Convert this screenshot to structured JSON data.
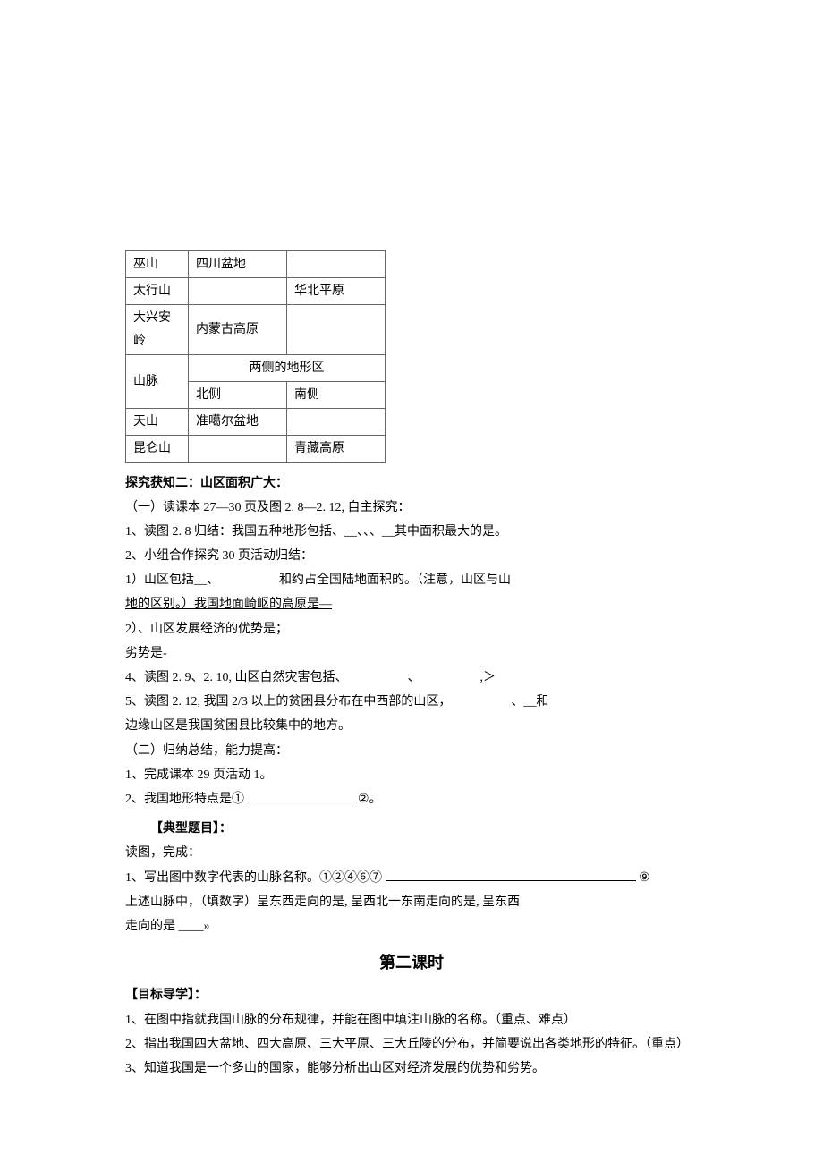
{
  "table1": {
    "rows": [
      [
        "巫山",
        "四川盆地",
        ""
      ],
      [
        "太行山",
        "",
        "华北平原"
      ],
      [
        "大兴安岭",
        "内蒙古高原",
        ""
      ]
    ],
    "header2_label": "两侧的地形区",
    "mountain_label": "山脉",
    "sub_north": "北侧",
    "sub_south": "南侧",
    "rows2": [
      [
        "天山",
        "准噶尔盆地",
        ""
      ],
      [
        "昆仑山",
        "",
        "青藏高原"
      ]
    ]
  },
  "section2": {
    "title": "探究获知二：山区面积广大：",
    "part1_intro": "（一）读课本 27—30 页及图 2. 8—2. 12, 自主探究：",
    "item1": "1、读图 2. 8 归结：我国五种地形包括、__、、、__其中面积最大的是。",
    "item2": "2、小组合作探究 30 页活动归结：",
    "item2_1a": "1）山区包括__、",
    "item2_1b": "和约占全国陆地面积的。（注意，山区与山",
    "item2_1c": "地的区别。）我国地面崎岖的高原是—",
    "item2_2a": "2）、山区发展经济的优势是；",
    "item2_2b": "劣势是-",
    "item4": "4、读图 2. 9、2. 10, 山区自然灾害包括、",
    "item4_mid": "、",
    "item4_end": ",＞",
    "item5a": "5、读图 2. 12, 我国 2/3 以上的贫困县分布在中西部的山区，",
    "item5b": "、__和",
    "item5c": "边缘山区是我国贫困县比较集中的地方。",
    "part2_intro": "（二）归纳总结，能力提高：",
    "part2_1": "1、完成课本 29 页活动 1。",
    "part2_2a": "2、我国地形特点是① ",
    "part2_2b": "②。"
  },
  "typical": {
    "title": "【典型题目】：",
    "intro": "读图，完成：",
    "q1a": "1、写出图中数字代表的山脉名称。①②④⑥⑦",
    "q1b": "⑨",
    "q1c": "上述山脉中，（填数字）呈东西走向的是, 呈西北一东南走向的是, 呈东西",
    "q1d": "走向的是 ____»"
  },
  "lesson2": {
    "title": "第二课时",
    "goal_title": "【目标导学】：",
    "goal1": "1、在图中指就我国山脉的分布规律，并能在图中填注山脉的名称。（重点、难点）",
    "goal2": "2、指出我国四大盆地、四大高原、三大平原、三大丘陵的分布，并简要说出各类地形的特征。（重点）",
    "goal3": "3、知道我国是一个多山的国家，能够分析出山区对经济发展的优势和劣势。"
  }
}
